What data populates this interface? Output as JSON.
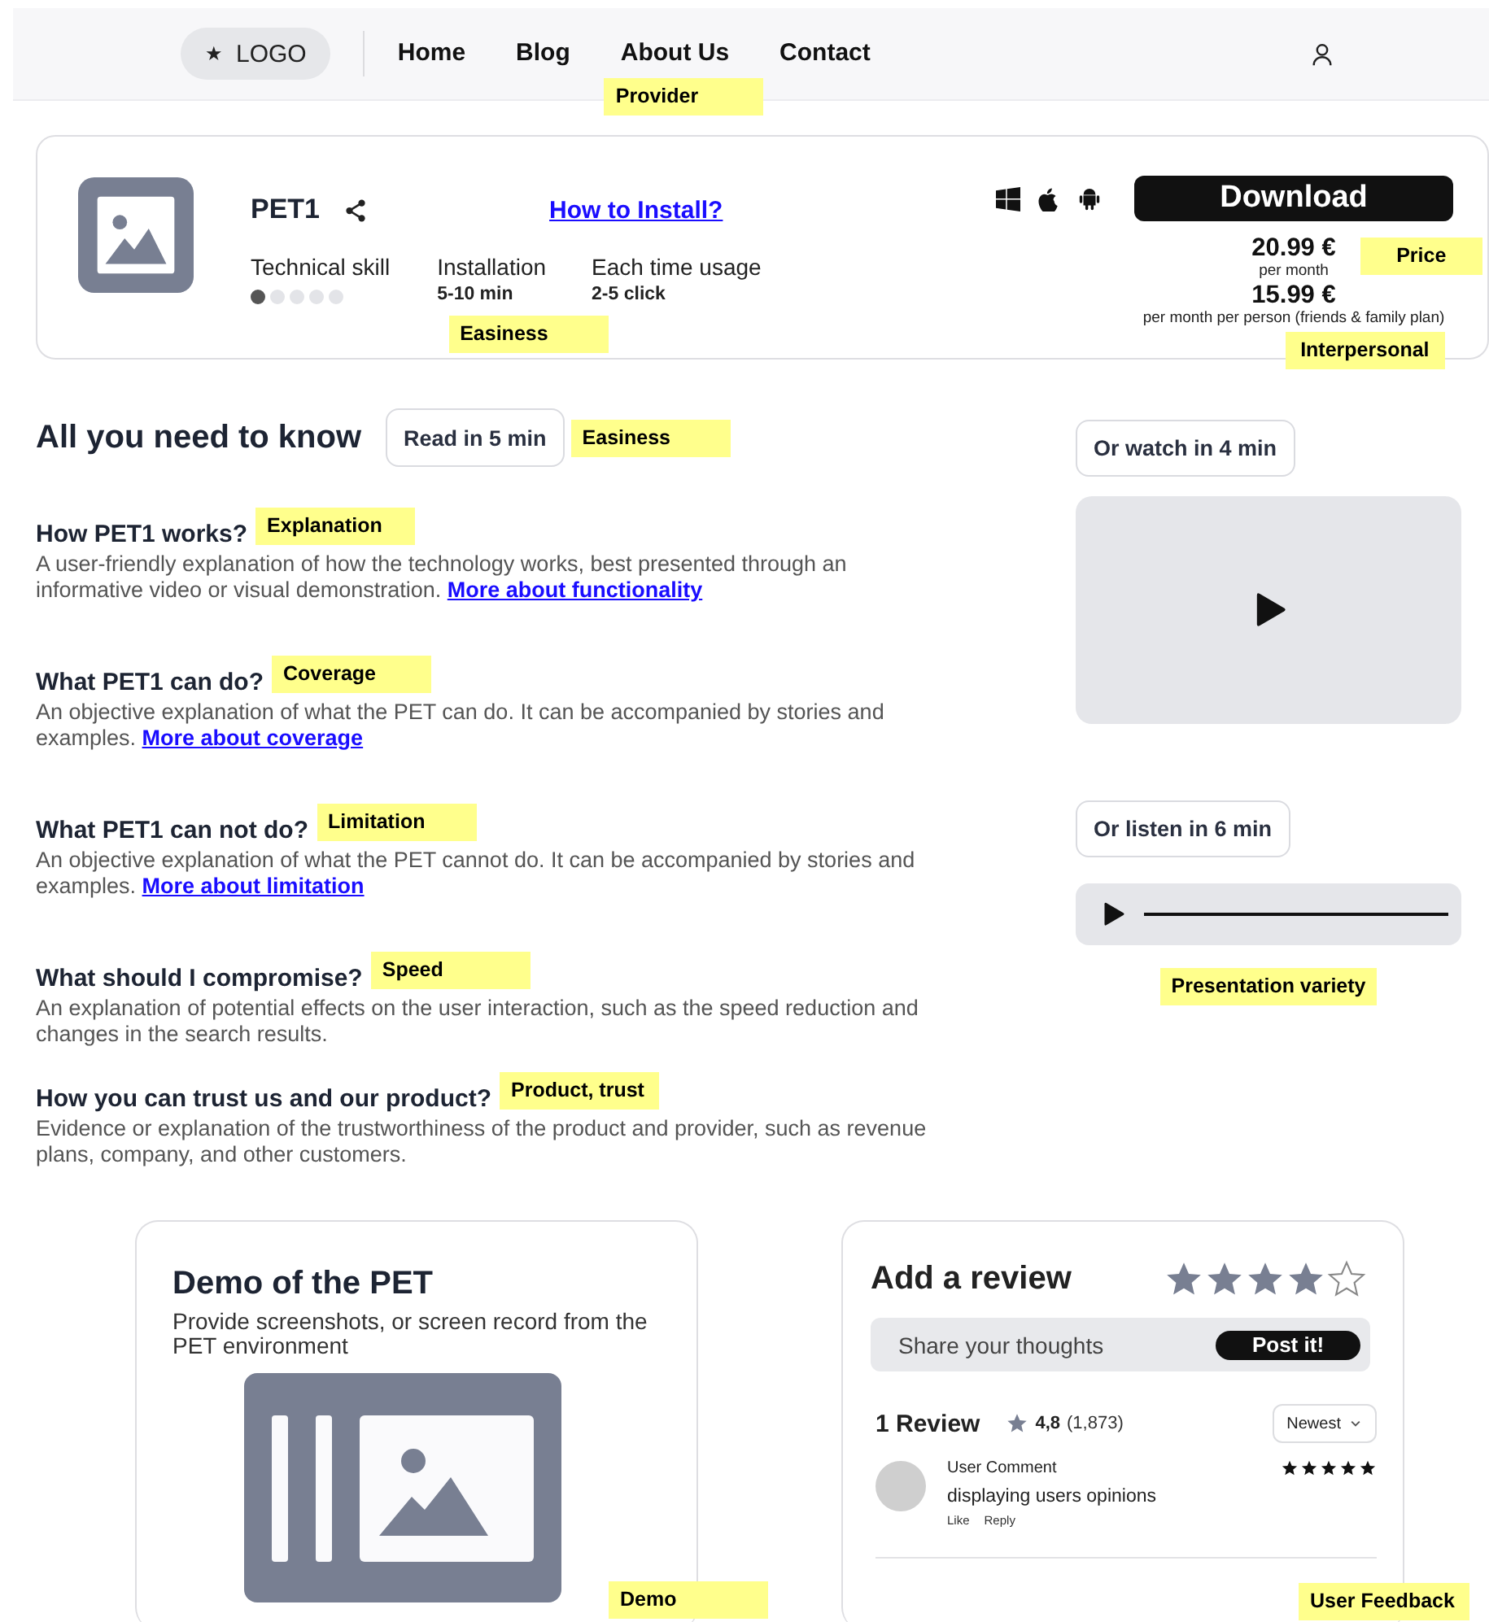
{
  "header": {
    "logo_mark": "★",
    "logo": "LOGO",
    "nav": [
      {
        "label": "Home"
      },
      {
        "label": "Blog"
      },
      {
        "label": "About Us",
        "note": "Provider"
      },
      {
        "label": "Contact"
      }
    ]
  },
  "product": {
    "name": "PET1",
    "install_link": "How to Install?",
    "download": "Download",
    "metrics": [
      {
        "kind": "dots",
        "label": "Technical skill",
        "stars": 1
      },
      {
        "kind": "text",
        "label": "Installation",
        "value": "5-10 min",
        "note": "Easiness"
      },
      {
        "kind": "text",
        "label": "Each time usage",
        "value": "2-5 click"
      }
    ],
    "prices": [
      {
        "amount": "20.99 €",
        "period": "per month",
        "note": "Price"
      },
      {
        "amount": "15.99 €",
        "period": "per month per person (friends & family plan)",
        "note": "Interpersonal"
      }
    ]
  },
  "info": {
    "title": "All you need to know",
    "read_time": "Read in 5 min",
    "read_note": "Easiness",
    "sections": [
      {
        "heading": "How PET1 works?",
        "note": "Explanation",
        "text": "A user-friendly explanation of how the technology works, best presented through an informative video or visual demonstration.",
        "link": "More about functionality"
      },
      {
        "heading": "What PET1 can do?",
        "note": "Coverage",
        "text": "An objective explanation of what the PET can do. It can be accompanied by stories and examples.",
        "link": "More about coverage"
      },
      {
        "heading": "What PET1 can not do?",
        "note": "Limitation",
        "text": "An objective explanation of what the PET cannot do. It can be accompanied by stories and examples.",
        "link": "More about limitation"
      },
      {
        "heading": "What should I compromise?",
        "note": "Speed",
        "text": "An explanation of potential effects on the user interaction, such as the speed reduction and changes in the search results."
      },
      {
        "heading": "How you can trust us and our product?",
        "note": "Product, trust",
        "text": "Evidence or explanation of the trustworthiness of the product and provider, such as revenue plans, company, and other customers."
      }
    ],
    "watch": "Or watch in 4 min",
    "listen": "Or listen in 6 min",
    "media_note": "Presentation variety"
  },
  "demo": {
    "title": "Demo of the PET",
    "text": "Provide screenshots, or screen record from the PET environment",
    "note": "Demo"
  },
  "review": {
    "title": "Add a review",
    "stars": 4,
    "placeholder": "Share your thoughts",
    "post": "Post it!",
    "count": "1 Review",
    "rating": "4,8",
    "rating_count": "(1,873)",
    "sort": "Newest",
    "comments": [
      {
        "author": "User Comment",
        "text": "displaying users opinions",
        "stars": 5,
        "actions": [
          "Like",
          "Reply"
        ]
      }
    ],
    "note": "User Feedback"
  }
}
